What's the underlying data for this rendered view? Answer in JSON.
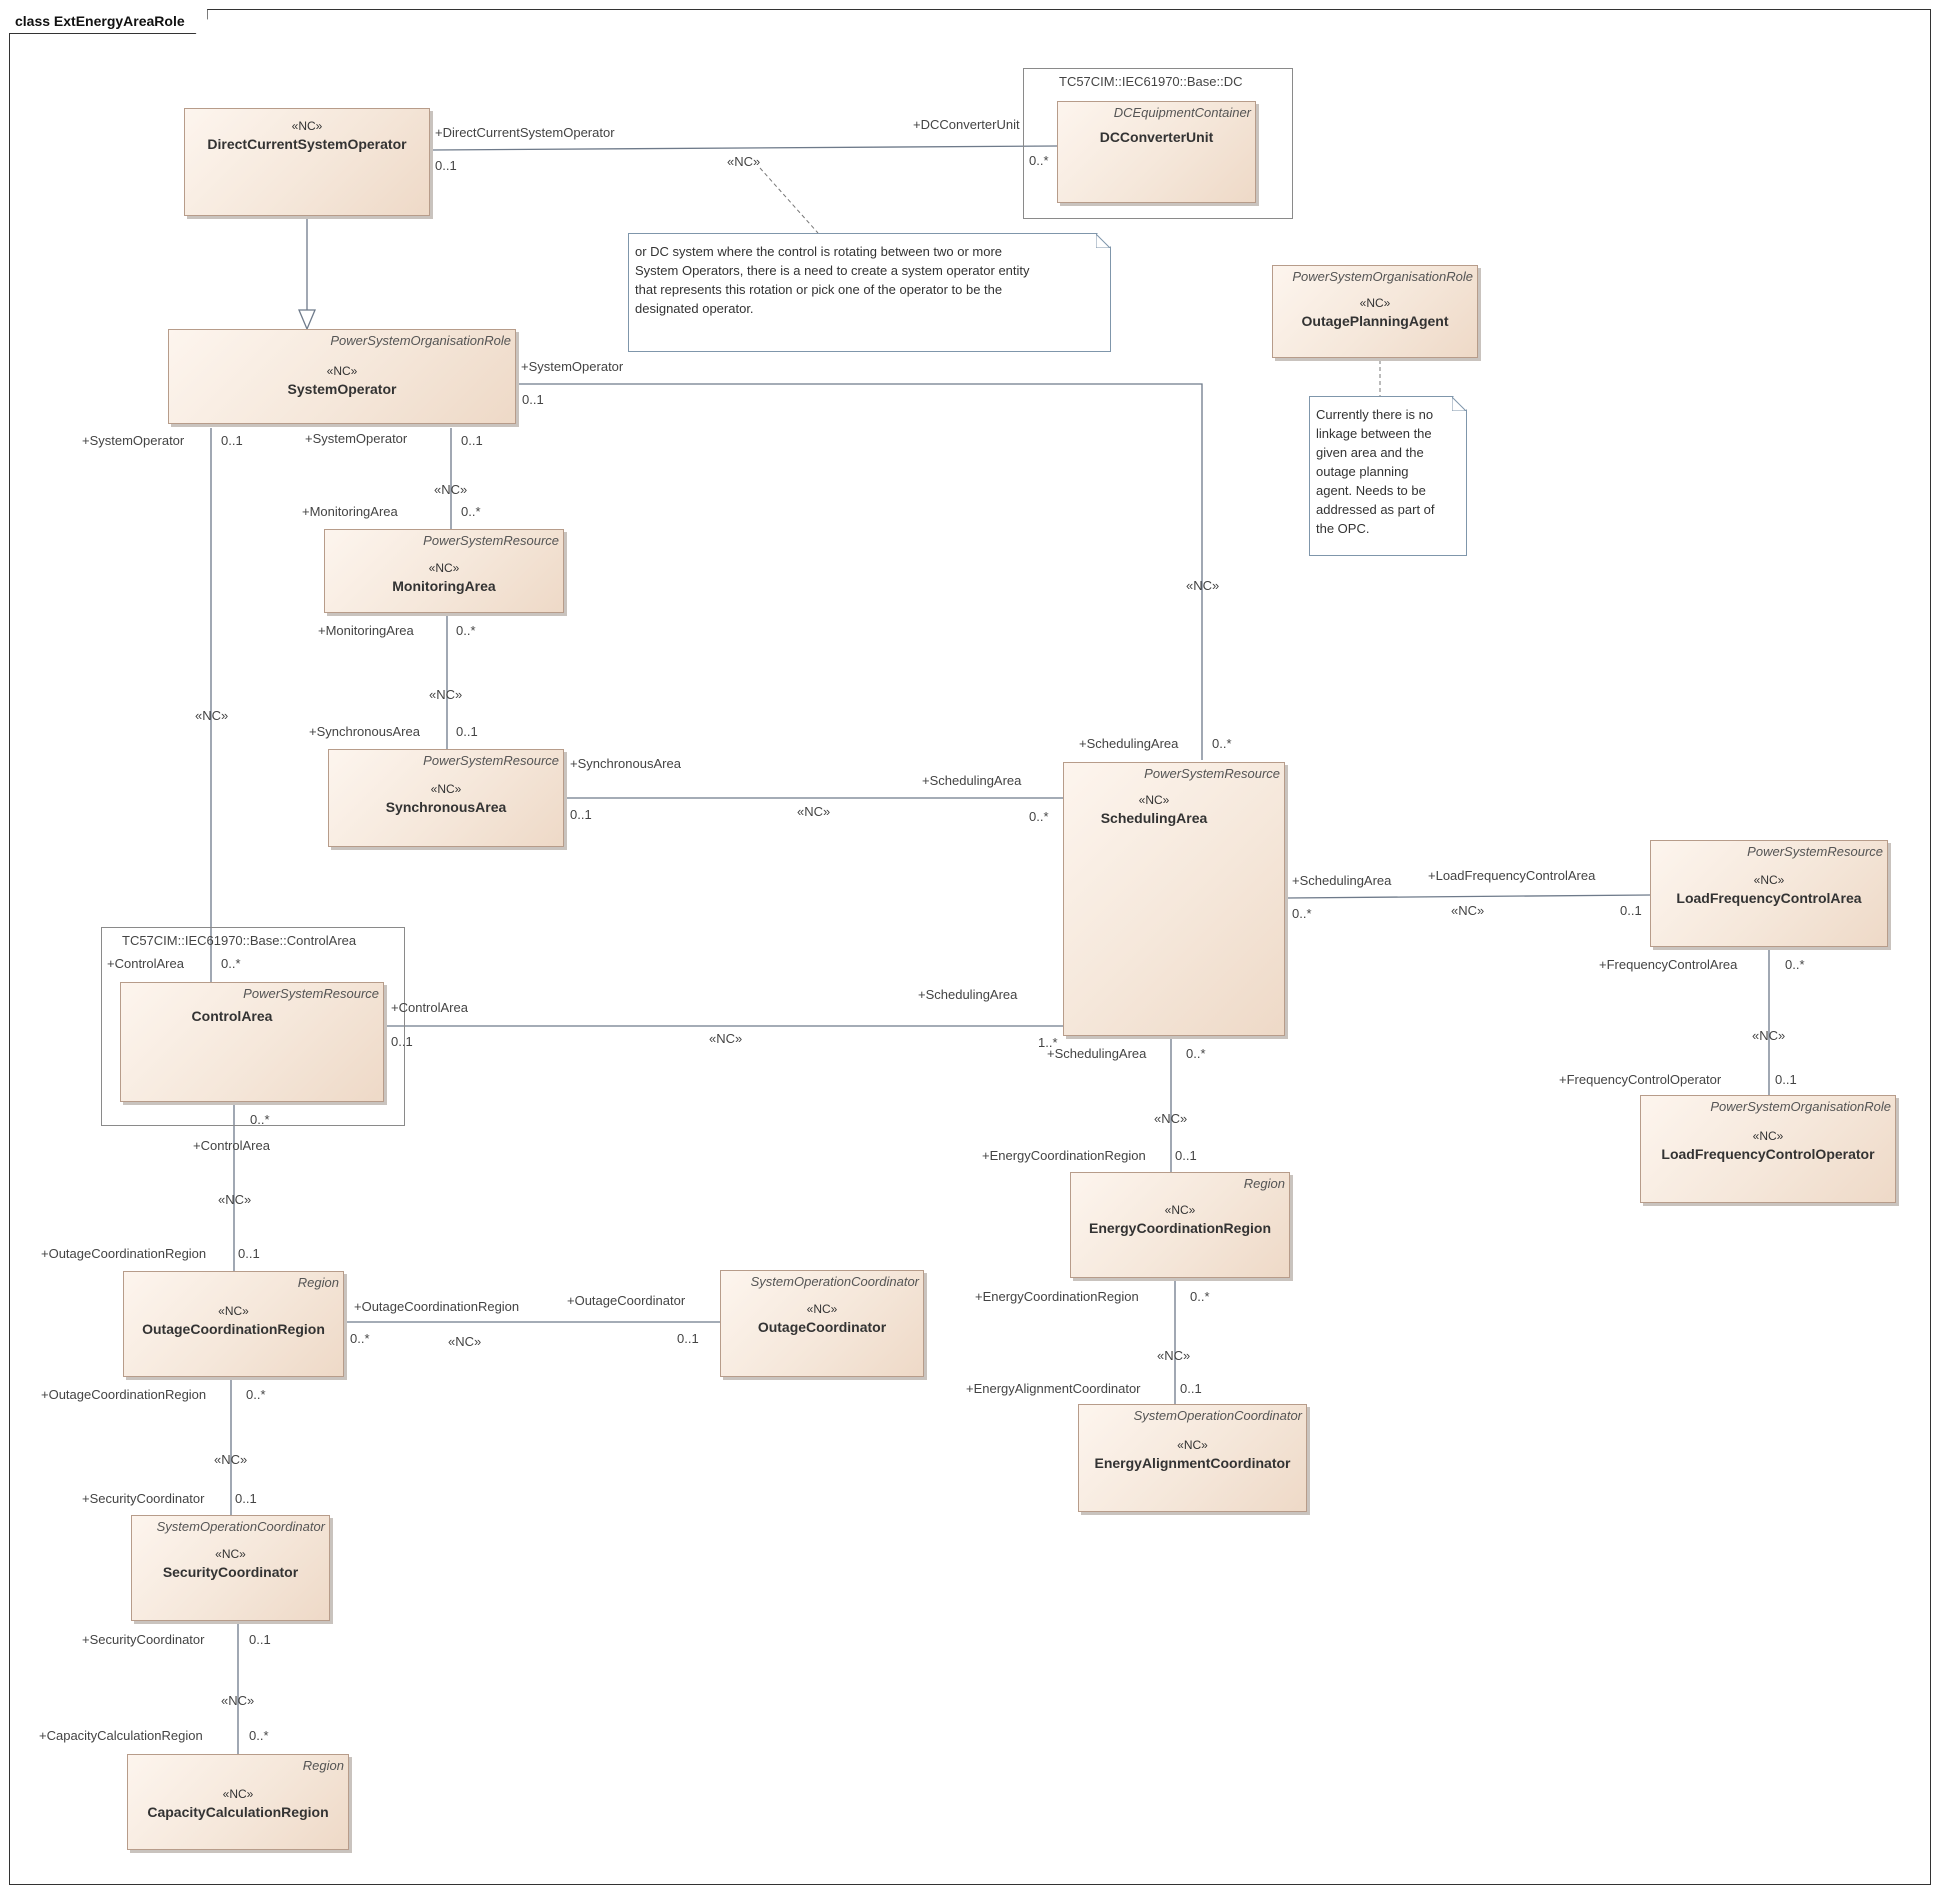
{
  "diagram": {
    "frame_title": "class ExtEnergyAreaRole"
  },
  "packages": {
    "dc": "TC57CIM::IEC61970::Base::DC",
    "control_area": "TC57CIM::IEC61970::Base::ControlArea"
  },
  "classes": {
    "direct_current_system_operator": {
      "stereotype": "«NC»",
      "name": "DirectCurrentSystemOperator",
      "type": ""
    },
    "dc_converter_unit": {
      "stereotype": "",
      "name": "DCConverterUnit",
      "type": "DCEquipmentContainer"
    },
    "system_operator": {
      "stereotype": "«NC»",
      "name": "SystemOperator",
      "type": "PowerSystemOrganisationRole"
    },
    "outage_planning_agent": {
      "stereotype": "«NC»",
      "name": "OutagePlanningAgent",
      "type": "PowerSystemOrganisationRole"
    },
    "monitoring_area": {
      "stereotype": "«NC»",
      "name": "MonitoringArea",
      "type": "PowerSystemResource"
    },
    "synchronous_area": {
      "stereotype": "«NC»",
      "name": "SynchronousArea",
      "type": "PowerSystemResource"
    },
    "scheduling_area": {
      "stereotype": "«NC»",
      "name": "SchedulingArea",
      "type": "PowerSystemResource"
    },
    "load_frequency_control_area": {
      "stereotype": "«NC»",
      "name": "LoadFrequencyControlArea",
      "type": "PowerSystemResource"
    },
    "load_frequency_control_operator": {
      "stereotype": "«NC»",
      "name": "LoadFrequencyControlOperator",
      "type": "PowerSystemOrganisationRole"
    },
    "control_area": {
      "stereotype": "",
      "name": "ControlArea",
      "type": "PowerSystemResource"
    },
    "energy_coordination_region": {
      "stereotype": "«NC»",
      "name": "EnergyCoordinationRegion",
      "type": "Region"
    },
    "energy_alignment_coordinator": {
      "stereotype": "«NC»",
      "name": "EnergyAlignmentCoordinator",
      "type": "SystemOperationCoordinator"
    },
    "outage_coordination_region": {
      "stereotype": "«NC»",
      "name": "OutageCoordinationRegion",
      "type": "Region"
    },
    "outage_coordinator": {
      "stereotype": "«NC»",
      "name": "OutageCoordinator",
      "type": "SystemOperationCoordinator"
    },
    "security_coordinator": {
      "stereotype": "«NC»",
      "name": "SecurityCoordinator",
      "type": "SystemOperationCoordinator"
    },
    "capacity_calculation_region": {
      "stereotype": "«NC»",
      "name": "CapacityCalculationRegion",
      "type": "Region"
    }
  },
  "notes": {
    "dc_note": [
      "or DC system where the control is rotating between two or more",
      "System Operators, there is a need to create a system operator entity",
      "that represents this rotation or pick one of the operator to be the",
      "designated operator."
    ],
    "opa_note": [
      "Currently there is no",
      "linkage between the",
      "given area and the",
      "outage planning",
      "agent. Needs to be",
      "addressed as part of",
      "the OPC."
    ]
  },
  "edge_labels": {
    "dcso_role": "+DirectCurrentSystemOperator",
    "dcso_mult": "0..1",
    "dcu_role": "+DCConverterUnit",
    "dcu_mult": "0..*",
    "dc_stereo": "«NC»",
    "so_sched_role": "+SystemOperator",
    "so_sched_mult": "0..1",
    "so_sched_stereo": "«NC»",
    "sched_so_role": "+SchedulingArea",
    "sched_so_mult": "0..*",
    "so_ca_role": "+SystemOperator",
    "so_ca_mult": "0..1",
    "so_ca_stereo": "«NC»",
    "ca_so_role": "+ControlArea",
    "ca_so_mult": "0..*",
    "so_ma_role": "+SystemOperator",
    "so_ma_mult": "0..1",
    "so_ma_stereo": "«NC»",
    "ma_so_role": "+MonitoringArea",
    "ma_so_mult": "0..*",
    "ma_sa_role": "+MonitoringArea",
    "ma_sa_mult": "0..*",
    "ma_sa_stereo": "«NC»",
    "sa_ma_role": "+SynchronousArea",
    "sa_ma_mult": "0..1",
    "sa_sched_role": "+SynchronousArea",
    "sa_sched_mult": "0..1",
    "sa_sched_stereo": "«NC»",
    "sched_sa_role": "+SchedulingArea",
    "sched_sa_mult": "0..*",
    "ca_sched_role": "+ControlArea",
    "ca_sched_mult": "0..1",
    "ca_sched_stereo": "«NC»",
    "sched_ca_role": "+SchedulingArea",
    "sched_ca_mult": "1..*",
    "sched_lfca_role": "+SchedulingArea",
    "sched_lfca_mult": "0..*",
    "sched_lfca_stereo": "«NC»",
    "lfca_sched_role": "+LoadFrequencyControlArea",
    "lfca_sched_mult": "0..1",
    "lfca_lfco_role": "+FrequencyControlArea",
    "lfca_lfco_mult": "0..*",
    "lfca_lfco_stereo": "«NC»",
    "lfco_lfca_role": "+FrequencyControlOperator",
    "lfco_lfca_mult": "0..1",
    "sched_ecr_role": "+SchedulingArea",
    "sched_ecr_mult": "0..*",
    "sched_ecr_stereo": "«NC»",
    "ecr_sched_role": "+EnergyCoordinationRegion",
    "ecr_sched_mult": "0..1",
    "ecr_eac_role": "+EnergyCoordinationRegion",
    "ecr_eac_mult": "0..*",
    "ecr_eac_stereo": "«NC»",
    "eac_ecr_role": "+EnergyAlignmentCoordinator",
    "eac_ecr_mult": "0..1",
    "ca_ocr_role": "+ControlArea",
    "ca_ocr_mult": "0..*",
    "ca_ocr_stereo": "«NC»",
    "ocr_ca_role": "+OutageCoordinationRegion",
    "ocr_ca_mult": "0..1",
    "ocr_oc_role": "+OutageCoordinationRegion",
    "ocr_oc_mult": "0..*",
    "ocr_oc_stereo": "«NC»",
    "oc_ocr_role": "+OutageCoordinator",
    "oc_ocr_mult": "0..1",
    "ocr_sc_role": "+OutageCoordinationRegion",
    "ocr_sc_mult": "0..*",
    "ocr_sc_stereo": "«NC»",
    "sc_ocr_role": "+SecurityCoordinator",
    "sc_ocr_mult": "0..1",
    "sc_ccr_role": "+SecurityCoordinator",
    "sc_ccr_mult": "0..1",
    "sc_ccr_stereo": "«NC»",
    "ccr_sc_role": "+CapacityCalculationRegion",
    "ccr_sc_mult": "0..*"
  },
  "colors": {
    "line": "#6e7a8a",
    "note_border": "#7f96ab",
    "class_border": "#b79c8a",
    "dashed": "#777777"
  }
}
